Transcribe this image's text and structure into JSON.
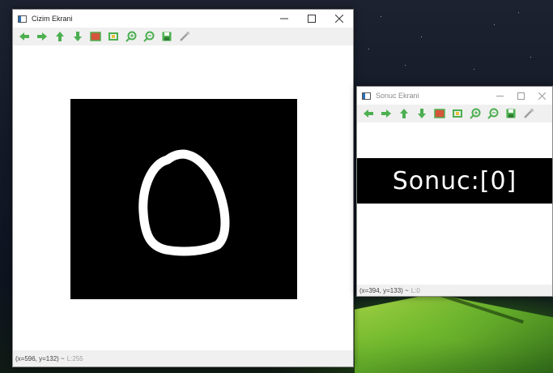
{
  "main_window": {
    "title": "Cizim Ekrani",
    "status": {
      "coords": "(x=596, y=132) ~",
      "value": "L:255"
    },
    "drawn_digit": "0"
  },
  "result_window": {
    "title": "Sonuc Ekrani",
    "result_text": "Sonuc:[0]",
    "status": {
      "coords": "(x=394, y=133) ~",
      "value": "L:0"
    }
  },
  "toolbar_icons": [
    "pan-left-icon",
    "pan-right-icon",
    "pan-up-icon",
    "pan-down-icon",
    "zoom-to-fit-icon",
    "zoom-original-icon",
    "zoom-in-icon",
    "zoom-out-icon",
    "save-icon",
    "properties-icon"
  ],
  "colors": {
    "icon_green": "#4caf50",
    "canvas_bg": "#000000",
    "stroke": "#ffffff"
  }
}
